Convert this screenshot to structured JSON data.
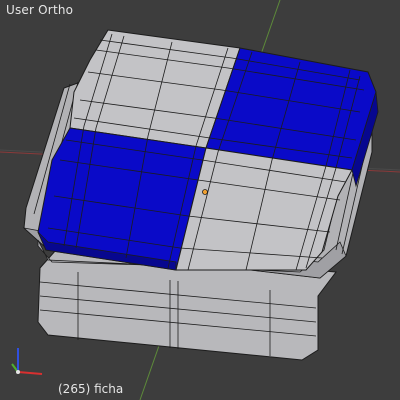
{
  "viewport": {
    "view_label": "User Ortho",
    "object_label": "(265) ficha"
  },
  "colors": {
    "background": "#3d3d3d",
    "grid_line": "#4a4a4a",
    "axis_x": "#8a3a3a",
    "axis_y": "#5d8a3a",
    "mesh_gray": "#b6b6b9",
    "mesh_gray_light": "#c9c9cc",
    "mesh_gray_dark": "#8f8f93",
    "mesh_blue": "#0a0ac8",
    "mesh_blue_dark": "#07078f",
    "wire": "#1c1c1c",
    "origin": "#f0a030"
  },
  "gizmo": {
    "x_color": "#d83030",
    "y_color": "#50b030",
    "z_color": "#3050e0"
  }
}
